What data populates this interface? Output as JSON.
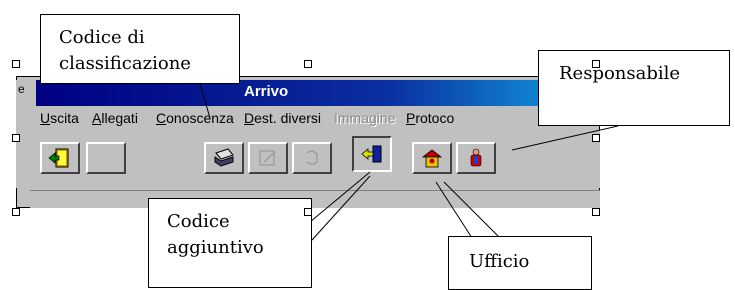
{
  "window": {
    "title": "Arrivo",
    "titlebar_stub": "e",
    "menu": [
      {
        "label": "Uscita",
        "underline": "U",
        "rest": "scita",
        "disabled": false
      },
      {
        "label": "Allegati",
        "underline": "A",
        "rest": "llegati",
        "disabled": false
      },
      {
        "label": "Conoscenza",
        "underline": "C",
        "rest": "onoscenza",
        "disabled": false
      },
      {
        "label": "Dest. diversi",
        "underline": "D",
        "rest": "est. diversi",
        "disabled": false
      },
      {
        "label": "Immagine",
        "underline": "",
        "rest": "Immagine",
        "disabled": true
      },
      {
        "label": "Protocollo",
        "underline": "P",
        "rest": "rotoco",
        "disabled": false
      }
    ],
    "toolbar": [
      {
        "name": "exit-button",
        "icon": "exit-door-icon",
        "pressed": false
      },
      {
        "name": "blank-button",
        "icon": "none",
        "pressed": false
      },
      {
        "name": "print-button",
        "icon": "printer-icon",
        "pressed": false
      },
      {
        "name": "edit-button",
        "icon": "edit-disabled-icon",
        "pressed": false
      },
      {
        "name": "refresh-button",
        "icon": "refresh-disabled-icon",
        "pressed": false
      },
      {
        "name": "additional-code-button",
        "icon": "arrow-in-icon",
        "pressed": true
      },
      {
        "name": "office-button",
        "icon": "office-people-icon",
        "pressed": false
      },
      {
        "name": "responsible-button",
        "icon": "person-icon",
        "pressed": false
      }
    ]
  },
  "callouts": {
    "codice_classificazione_line1": "Codice di",
    "codice_classificazione_line2": "classificazione",
    "responsabile": "Responsabile",
    "codice_aggiuntivo_line1": "Codice",
    "codice_aggiuntivo_line2": "aggiuntivo",
    "ufficio": "Ufficio"
  },
  "colors": {
    "titlebar_start": "#000080",
    "titlebar_end": "#1084d0",
    "face": "#c0c0c0"
  }
}
